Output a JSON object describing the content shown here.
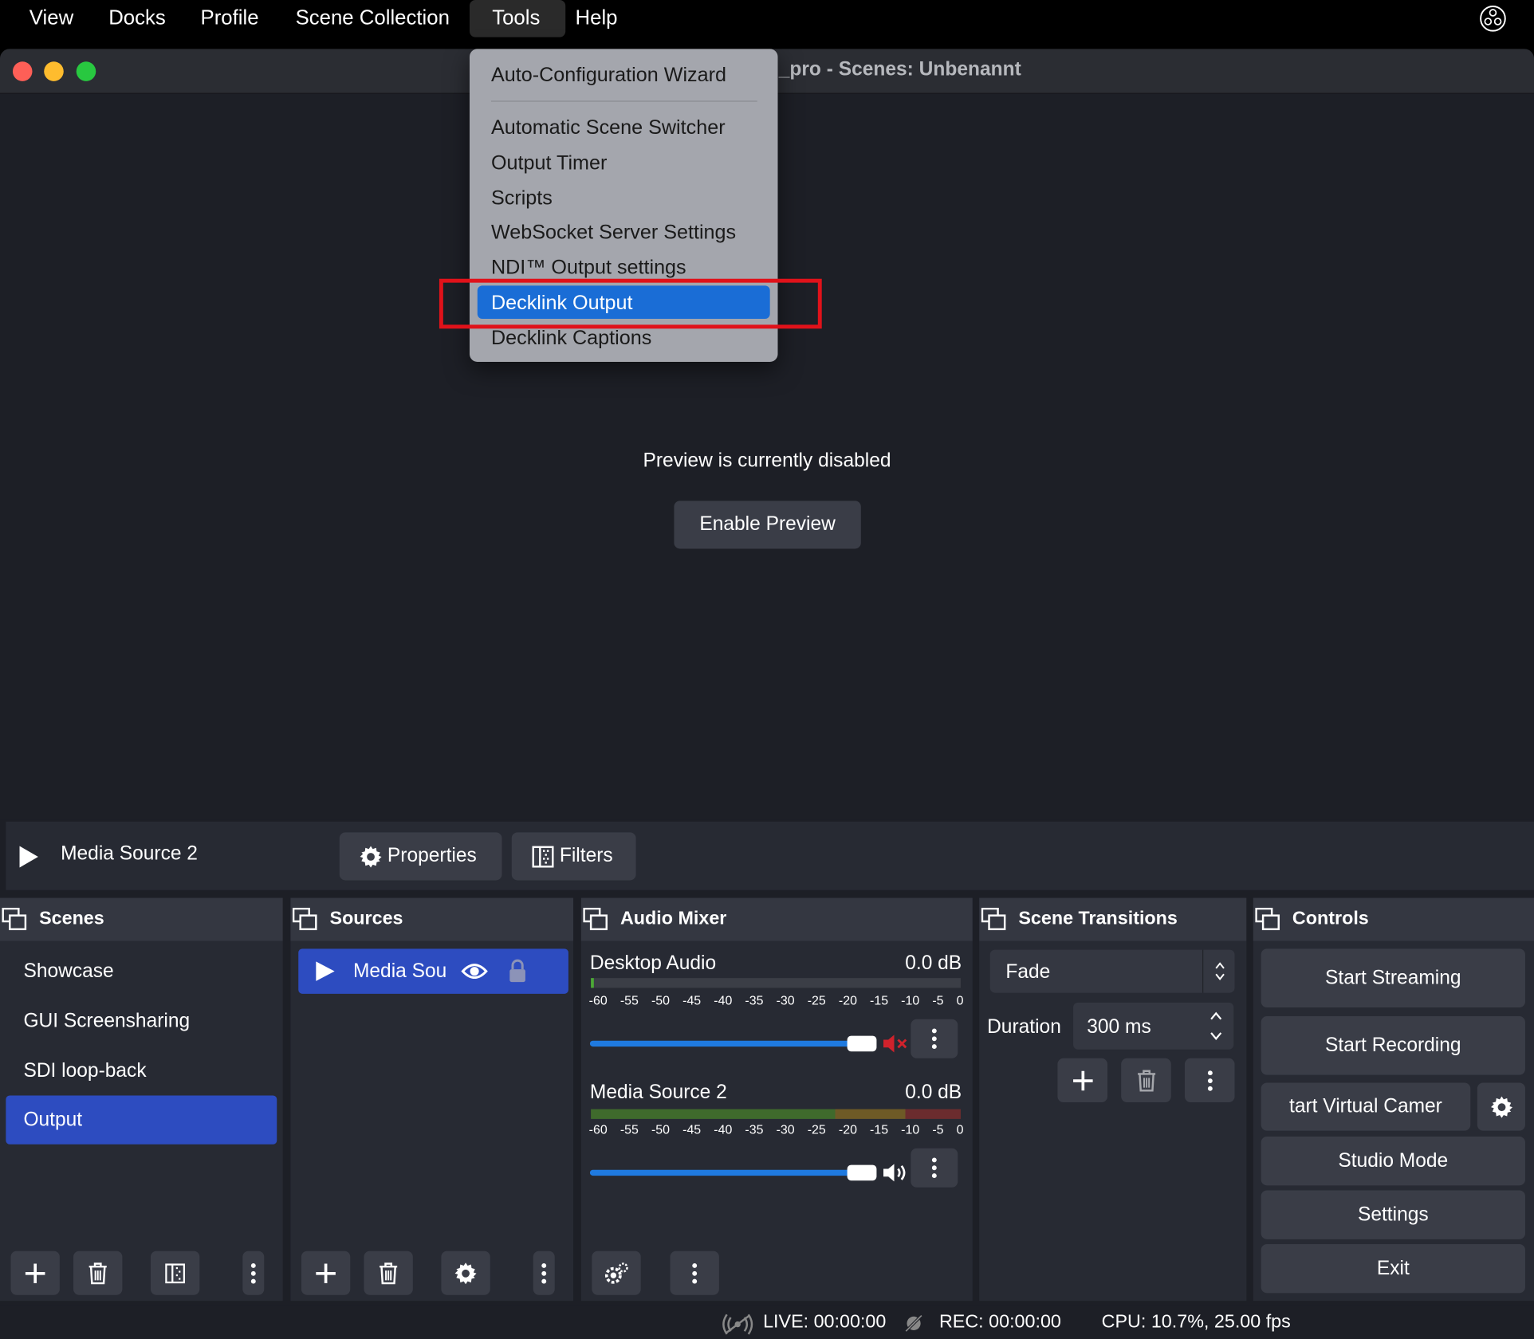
{
  "menubar": {
    "items": [
      "View",
      "Docks",
      "Profile",
      "Scene Collection",
      "Tools",
      "Help"
    ],
    "active": "Tools"
  },
  "window": {
    "title": "_pro - Scenes: Unbenannt"
  },
  "tools_menu": {
    "items": [
      "Auto-Configuration Wizard",
      "Automatic Scene Switcher",
      "Output Timer",
      "Scripts",
      "WebSocket Server Settings",
      "NDI™ Output settings",
      "Decklink Output",
      "Decklink Captions"
    ],
    "highlighted": "Decklink Output",
    "annotation_color": "#e0121a"
  },
  "preview": {
    "message": "Preview is currently disabled",
    "enable_label": "Enable Preview"
  },
  "source_toolbar": {
    "current_source": "Media Source 2",
    "properties_label": "Properties",
    "filters_label": "Filters"
  },
  "scenes": {
    "title": "Scenes",
    "items": [
      "Showcase",
      "GUI Screensharing",
      "SDI loop-back",
      "Output"
    ],
    "selected": "Output"
  },
  "sources": {
    "title": "Sources",
    "items": [
      {
        "label": "Media Sou",
        "visible": true,
        "locked": false
      }
    ]
  },
  "audio_mixer": {
    "title": "Audio Mixer",
    "channels": [
      {
        "name": "Desktop Audio",
        "db": "0.0 dB",
        "muted": true
      },
      {
        "name": "Media Source 2",
        "db": "0.0 dB",
        "muted": false
      }
    ],
    "ticks": [
      "-60",
      "-55",
      "-50",
      "-45",
      "-40",
      "-35",
      "-30",
      "-25",
      "-20",
      "-15",
      "-10",
      "-5",
      "0"
    ]
  },
  "transitions": {
    "title": "Scene Transitions",
    "selected": "Fade",
    "duration_label": "Duration",
    "duration_value": "300 ms"
  },
  "controls": {
    "title": "Controls",
    "start_streaming": "Start Streaming",
    "start_recording": "Start Recording",
    "virtual_camera": "tart Virtual Camer",
    "studio_mode": "Studio Mode",
    "settings": "Settings",
    "exit": "Exit"
  },
  "status": {
    "live": "LIVE: 00:00:00",
    "rec": "REC: 00:00:00",
    "cpu": "CPU: 10.7%, 25.00 fps"
  },
  "colors": {
    "accent": "#2d4cc0",
    "menu_highlight": "#1a6dd6",
    "slider": "#1f7ae0",
    "mute_red": "#d0222c"
  }
}
